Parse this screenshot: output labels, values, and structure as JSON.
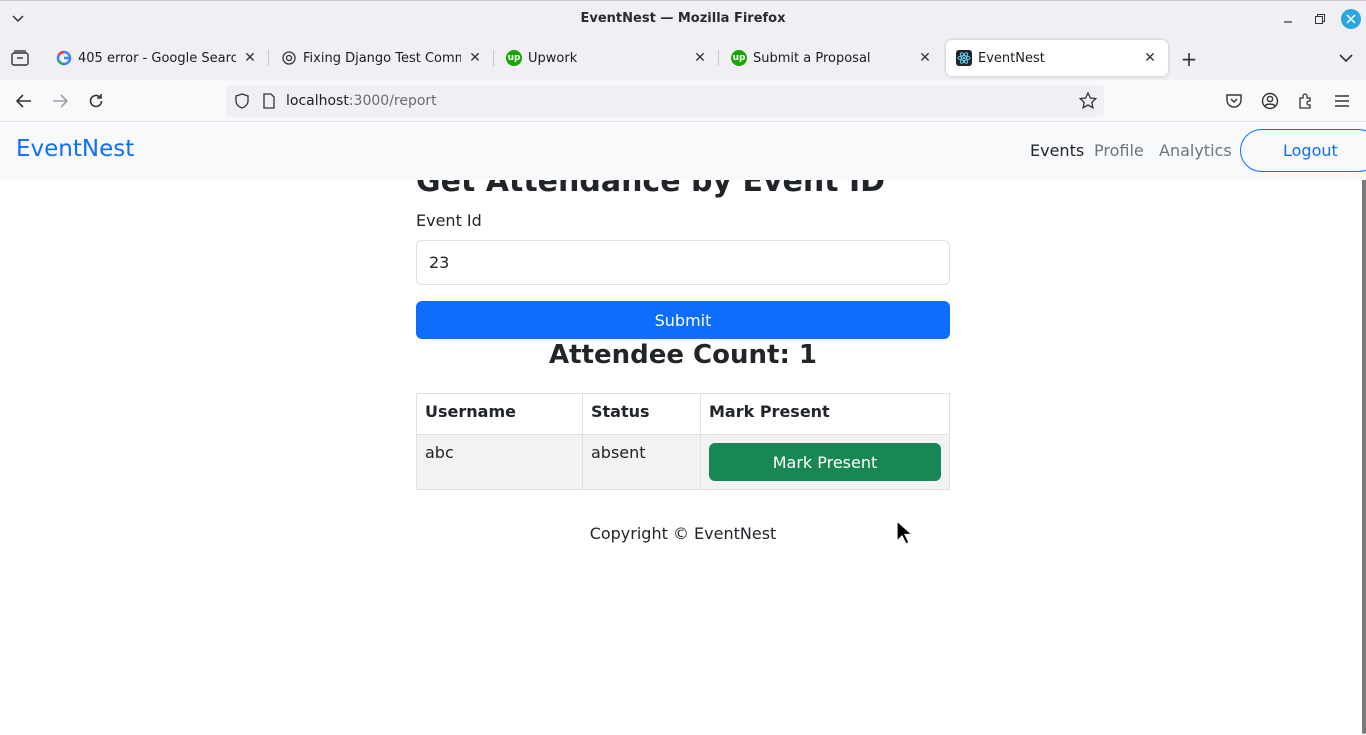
{
  "window": {
    "title": "EventNest — Mozilla Firefox"
  },
  "tabs": [
    {
      "label": "405 error - Google Search",
      "icon": "google-icon"
    },
    {
      "label": "Fixing Django Test Comman",
      "icon": "openai-icon"
    },
    {
      "label": "Upwork",
      "icon": "upwork-icon"
    },
    {
      "label": "Submit a Proposal",
      "icon": "upwork-icon"
    },
    {
      "label": "EventNest",
      "icon": "react-icon",
      "active": true
    }
  ],
  "address": {
    "host": "localhost",
    "path": ":3000/report"
  },
  "app": {
    "brand": "EventNest",
    "nav": {
      "events": "Events",
      "profile": "Profile",
      "analytics": "Analytics",
      "logout": "Logout"
    }
  },
  "form": {
    "heading": "Get Attendance by Event ID",
    "label": "Event Id",
    "value": "23",
    "submit": "Submit"
  },
  "attendance": {
    "count_label": "Attendee Count: 1",
    "headers": [
      "Username",
      "Status",
      "Mark Present"
    ],
    "rows": [
      {
        "username": "abc",
        "status": "absent",
        "action": "Mark Present"
      }
    ]
  },
  "footer": {
    "text": "Copyright © EventNest"
  },
  "colors": {
    "primary": "#0d6efd",
    "success": "#198754"
  }
}
